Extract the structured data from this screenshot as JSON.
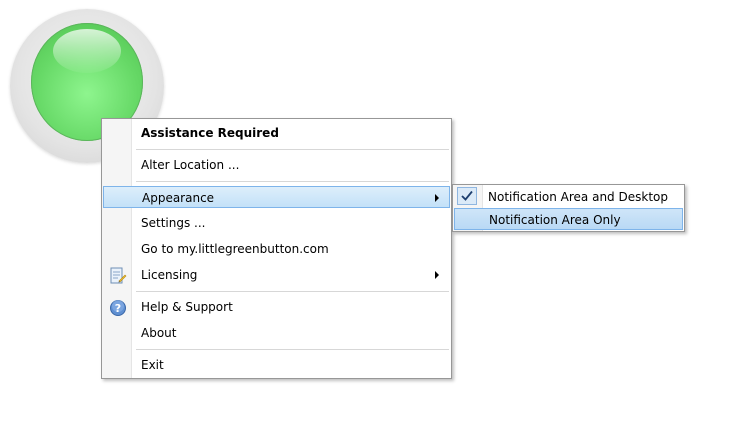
{
  "menu": {
    "items": [
      {
        "label": "Assistance Required"
      },
      {
        "label": "Alter Location ..."
      },
      {
        "label": "Appearance"
      },
      {
        "label": "Settings ..."
      },
      {
        "label": "Go to my.littlegreenbutton.com"
      },
      {
        "label": "Licensing"
      },
      {
        "label": "Help & Support"
      },
      {
        "label": "About"
      },
      {
        "label": "Exit"
      }
    ]
  },
  "submenu": {
    "items": [
      {
        "label": "Notification Area and Desktop",
        "checked": true
      },
      {
        "label": "Notification Area Only",
        "checked": false
      }
    ]
  },
  "icons": {
    "orb": "green-orb-icon",
    "licensing": "license-document-icon",
    "help": "help-question-icon",
    "check": "checkmark-icon",
    "submenu_arrow": "chevron-right-icon"
  },
  "colors": {
    "orb": "#67d967",
    "highlight": "#c3e1f8",
    "highlight_border": "#7eb4ea"
  }
}
